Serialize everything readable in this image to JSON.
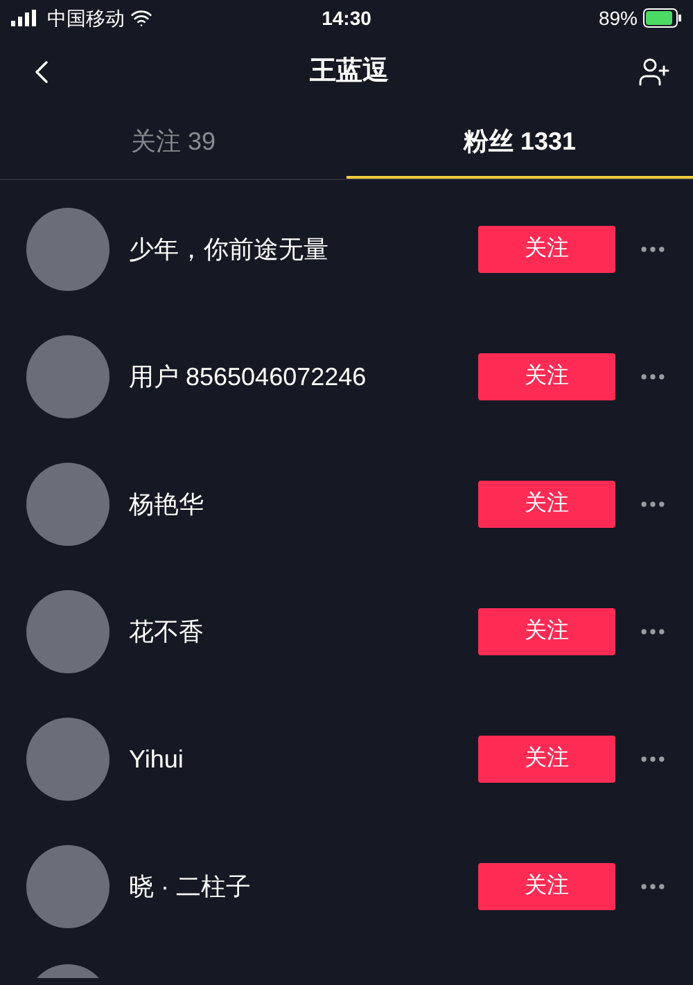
{
  "status_bar": {
    "carrier": "中国移动",
    "time": "14:30",
    "battery": "89%"
  },
  "header": {
    "title": "王蓝逗"
  },
  "tabs": [
    {
      "label": "关注 39",
      "selected": false
    },
    {
      "label": "粉丝 1331",
      "selected": true
    }
  ],
  "users": [
    {
      "name": "少年，你前途无量",
      "button": "关注"
    },
    {
      "name": "用户 8565046072246",
      "button": "关注"
    },
    {
      "name": "杨艳华",
      "button": "关注"
    },
    {
      "name": "花不香",
      "button": "关注"
    },
    {
      "name": "Yihui",
      "button": "关注"
    },
    {
      "name": "晓 · 二柱子",
      "button": "关注"
    }
  ]
}
